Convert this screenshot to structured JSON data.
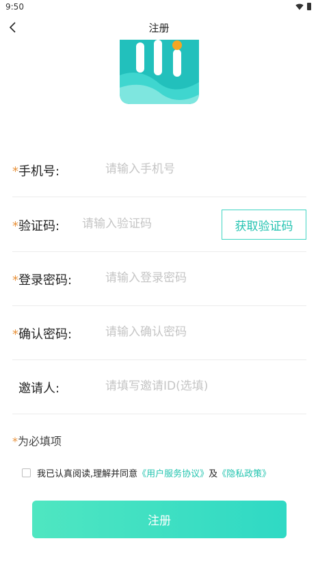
{
  "status_bar": {
    "time": "9:50"
  },
  "header": {
    "title": "注册"
  },
  "form": {
    "required_mark": "*",
    "phone": {
      "label": "手机号:",
      "placeholder": "请输入手机号"
    },
    "code": {
      "label": "验证码:",
      "placeholder": "请输入验证码",
      "button_label": "获取验证码"
    },
    "password": {
      "label": "登录密码:",
      "placeholder": "请输入登录密码"
    },
    "confirm_password": {
      "label": "确认密码:",
      "placeholder": "请输入确认密码"
    },
    "inviter": {
      "label": "邀请人:",
      "placeholder": "请填写邀请ID(选填)"
    }
  },
  "required_note": {
    "star": "*",
    "text": "为必填项"
  },
  "agreement": {
    "checked": false,
    "text": "我已认真阅读,理解并同意",
    "link_terms": "《用户服务协议》",
    "conjunction": "及",
    "link_privacy": "《隐私政策》"
  },
  "submit": {
    "label": "注册"
  },
  "colors": {
    "accent": "#2fd9c4",
    "required_star": "#e8913a",
    "link": "#22c4af"
  },
  "icons": {
    "back": "chevron-left-icon",
    "logo": "app-logo-icon"
  }
}
